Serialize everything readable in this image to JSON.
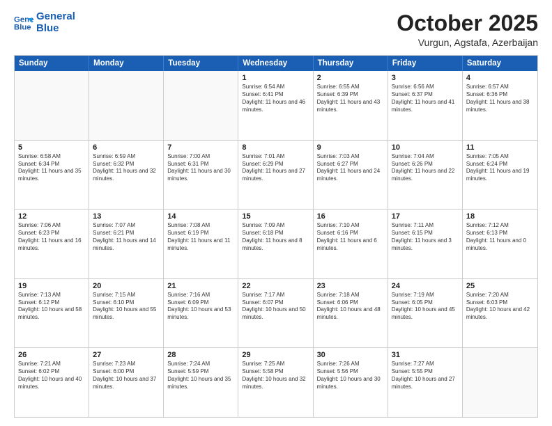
{
  "logo": {
    "line1": "General",
    "line2": "Blue"
  },
  "header": {
    "month": "October 2025",
    "location": "Vurgun, Agstafa, Azerbaijan"
  },
  "days": [
    "Sunday",
    "Monday",
    "Tuesday",
    "Wednesday",
    "Thursday",
    "Friday",
    "Saturday"
  ],
  "weeks": [
    [
      {
        "day": "",
        "empty": true
      },
      {
        "day": "",
        "empty": true
      },
      {
        "day": "",
        "empty": true
      },
      {
        "day": "1",
        "sunrise": "6:54 AM",
        "sunset": "6:41 PM",
        "daylight": "11 hours and 46 minutes."
      },
      {
        "day": "2",
        "sunrise": "6:55 AM",
        "sunset": "6:39 PM",
        "daylight": "11 hours and 43 minutes."
      },
      {
        "day": "3",
        "sunrise": "6:56 AM",
        "sunset": "6:37 PM",
        "daylight": "11 hours and 41 minutes."
      },
      {
        "day": "4",
        "sunrise": "6:57 AM",
        "sunset": "6:36 PM",
        "daylight": "11 hours and 38 minutes."
      }
    ],
    [
      {
        "day": "5",
        "sunrise": "6:58 AM",
        "sunset": "6:34 PM",
        "daylight": "11 hours and 35 minutes."
      },
      {
        "day": "6",
        "sunrise": "6:59 AM",
        "sunset": "6:32 PM",
        "daylight": "11 hours and 32 minutes."
      },
      {
        "day": "7",
        "sunrise": "7:00 AM",
        "sunset": "6:31 PM",
        "daylight": "11 hours and 30 minutes."
      },
      {
        "day": "8",
        "sunrise": "7:01 AM",
        "sunset": "6:29 PM",
        "daylight": "11 hours and 27 minutes."
      },
      {
        "day": "9",
        "sunrise": "7:03 AM",
        "sunset": "6:27 PM",
        "daylight": "11 hours and 24 minutes."
      },
      {
        "day": "10",
        "sunrise": "7:04 AM",
        "sunset": "6:26 PM",
        "daylight": "11 hours and 22 minutes."
      },
      {
        "day": "11",
        "sunrise": "7:05 AM",
        "sunset": "6:24 PM",
        "daylight": "11 hours and 19 minutes."
      }
    ],
    [
      {
        "day": "12",
        "sunrise": "7:06 AM",
        "sunset": "6:23 PM",
        "daylight": "11 hours and 16 minutes."
      },
      {
        "day": "13",
        "sunrise": "7:07 AM",
        "sunset": "6:21 PM",
        "daylight": "11 hours and 14 minutes."
      },
      {
        "day": "14",
        "sunrise": "7:08 AM",
        "sunset": "6:19 PM",
        "daylight": "11 hours and 11 minutes."
      },
      {
        "day": "15",
        "sunrise": "7:09 AM",
        "sunset": "6:18 PM",
        "daylight": "11 hours and 8 minutes."
      },
      {
        "day": "16",
        "sunrise": "7:10 AM",
        "sunset": "6:16 PM",
        "daylight": "11 hours and 6 minutes."
      },
      {
        "day": "17",
        "sunrise": "7:11 AM",
        "sunset": "6:15 PM",
        "daylight": "11 hours and 3 minutes."
      },
      {
        "day": "18",
        "sunrise": "7:12 AM",
        "sunset": "6:13 PM",
        "daylight": "11 hours and 0 minutes."
      }
    ],
    [
      {
        "day": "19",
        "sunrise": "7:13 AM",
        "sunset": "6:12 PM",
        "daylight": "10 hours and 58 minutes."
      },
      {
        "day": "20",
        "sunrise": "7:15 AM",
        "sunset": "6:10 PM",
        "daylight": "10 hours and 55 minutes."
      },
      {
        "day": "21",
        "sunrise": "7:16 AM",
        "sunset": "6:09 PM",
        "daylight": "10 hours and 53 minutes."
      },
      {
        "day": "22",
        "sunrise": "7:17 AM",
        "sunset": "6:07 PM",
        "daylight": "10 hours and 50 minutes."
      },
      {
        "day": "23",
        "sunrise": "7:18 AM",
        "sunset": "6:06 PM",
        "daylight": "10 hours and 48 minutes."
      },
      {
        "day": "24",
        "sunrise": "7:19 AM",
        "sunset": "6:05 PM",
        "daylight": "10 hours and 45 minutes."
      },
      {
        "day": "25",
        "sunrise": "7:20 AM",
        "sunset": "6:03 PM",
        "daylight": "10 hours and 42 minutes."
      }
    ],
    [
      {
        "day": "26",
        "sunrise": "7:21 AM",
        "sunset": "6:02 PM",
        "daylight": "10 hours and 40 minutes."
      },
      {
        "day": "27",
        "sunrise": "7:23 AM",
        "sunset": "6:00 PM",
        "daylight": "10 hours and 37 minutes."
      },
      {
        "day": "28",
        "sunrise": "7:24 AM",
        "sunset": "5:59 PM",
        "daylight": "10 hours and 35 minutes."
      },
      {
        "day": "29",
        "sunrise": "7:25 AM",
        "sunset": "5:58 PM",
        "daylight": "10 hours and 32 minutes."
      },
      {
        "day": "30",
        "sunrise": "7:26 AM",
        "sunset": "5:56 PM",
        "daylight": "10 hours and 30 minutes."
      },
      {
        "day": "31",
        "sunrise": "7:27 AM",
        "sunset": "5:55 PM",
        "daylight": "10 hours and 27 minutes."
      },
      {
        "day": "",
        "empty": true
      }
    ]
  ]
}
